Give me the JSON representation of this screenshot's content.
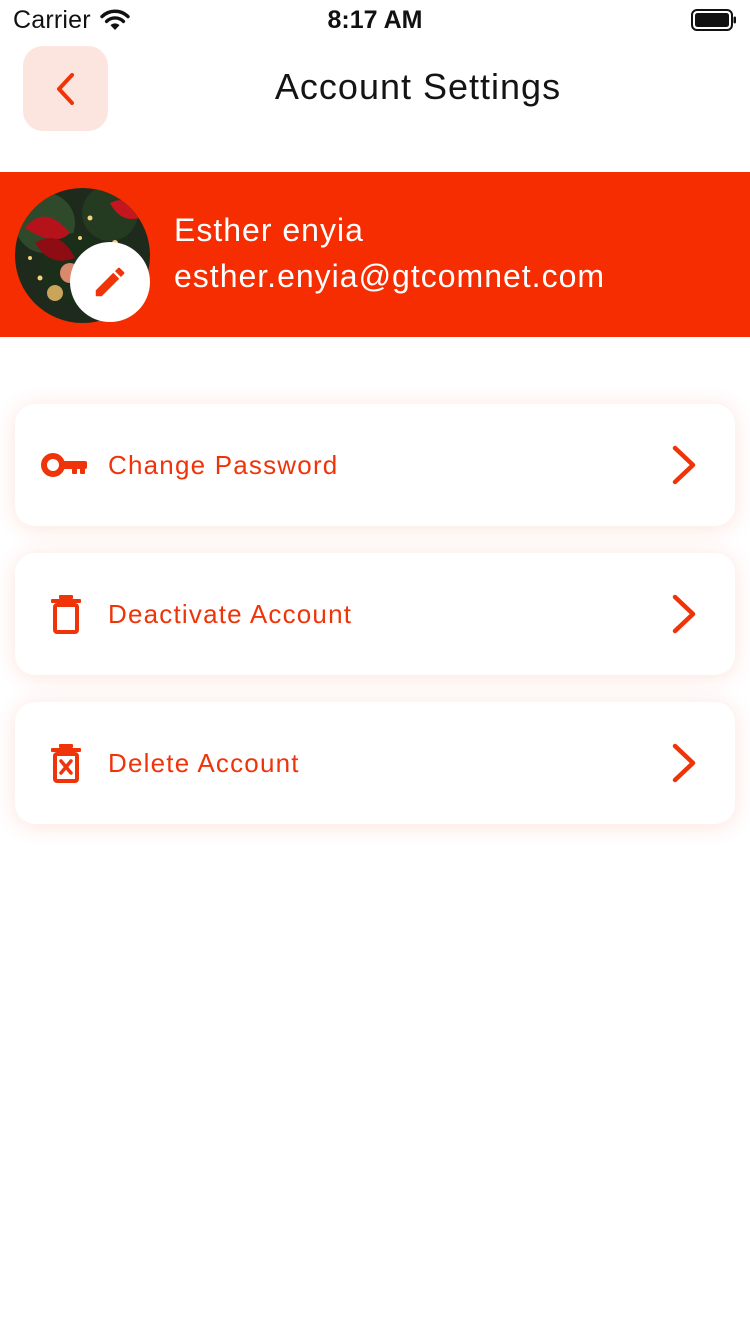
{
  "status_bar": {
    "carrier": "Carrier",
    "time": "8:17 AM",
    "wifi_icon": "wifi-icon",
    "battery_icon": "battery-full-icon"
  },
  "header": {
    "back_icon": "chevron-left-icon",
    "title": "Account Settings"
  },
  "profile": {
    "name": "Esther enyia",
    "email": "esther.enyia@gtcomnet.com",
    "edit_icon": "pencil-icon",
    "banner_color": "#f52d00"
  },
  "settings": [
    {
      "label": "Change Password",
      "icon": "key-icon"
    },
    {
      "label": "Deactivate Account",
      "icon": "trash-icon"
    },
    {
      "label": "Delete Account",
      "icon": "delete-x-icon"
    }
  ],
  "colors": {
    "accent": "#f0340a",
    "back_button_bg": "#fce5de"
  }
}
